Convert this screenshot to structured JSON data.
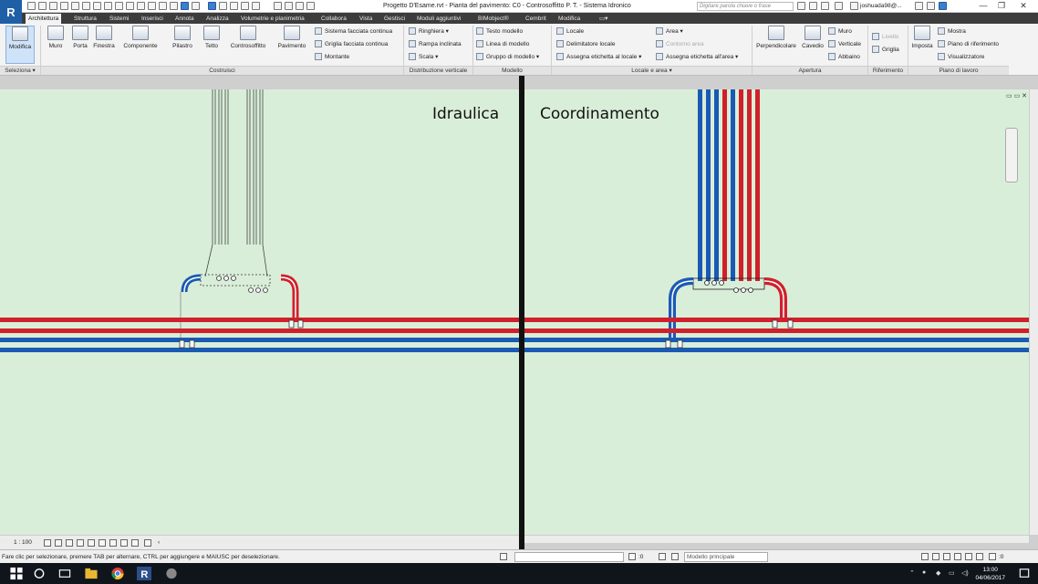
{
  "app": {
    "logo_letter": "R",
    "window_title": "Progetto D'Esame.rvt - Pianta del pavimento: C0 - Controsoffitto P. T. - Sistema Idronico",
    "search_placeholder": "Digitare parola chiave o frase",
    "username": "joshuada98@...",
    "window_controls": [
      "—",
      "❐",
      "✕"
    ]
  },
  "ribbon": {
    "tabs": [
      "Architettura",
      "Struttura",
      "Sistemi",
      "Inserisci",
      "Annota",
      "Analizza",
      "Volumetrie e planimetria",
      "Collabora",
      "Vista",
      "Gestisci",
      "Moduli aggiuntivi",
      "BIMobject®",
      "Cembrit",
      "Modifica",
      "▭▾"
    ],
    "active_tab": "Architettura",
    "seleziona": {
      "button": "Modifica",
      "panel": "Seleziona ▾"
    },
    "costruisci": {
      "panel": "Costruisci",
      "big_buttons": [
        "Muro",
        "Porta",
        "Finestra",
        "Componente",
        "Pilastro",
        "Tetto",
        "Controsoffitto",
        "Pavimento"
      ],
      "small_buttons": [
        "Sistema facciata continua",
        "Griglia facciata continua",
        "Montante"
      ]
    },
    "distribuzione": {
      "panel": "Distribuzione verticale",
      "items": [
        "Ringhiera ▾",
        "Rampa inclinata",
        "Scala ▾"
      ]
    },
    "modello": {
      "panel": "Modello",
      "items": [
        "Testo modello",
        "Linea di modello",
        "Gruppo di modello ▾"
      ]
    },
    "locale_area": {
      "panel": "Locale e area ▾",
      "items": [
        "Locale",
        "Delimitatore locale",
        "Assegna etichetta al locale ▾"
      ],
      "items2": [
        "Area ▾",
        "Contorno area",
        "Assegna etichetta all'area ▾"
      ]
    },
    "apertura": {
      "panel": "Apertura",
      "big_buttons": [
        "Perpendicolare",
        "Cavedio"
      ],
      "small_buttons": [
        "Muro",
        "Verticale",
        "Abbaino"
      ]
    },
    "riferimento": {
      "panel": "Riferimento",
      "items": [
        "Livello",
        "Griglia"
      ]
    },
    "piano_lavoro": {
      "panel": "Piano di lavoro",
      "big_button": "Imposta",
      "items": [
        "Mostra",
        "Piano di riferimento",
        "Visualizzatore"
      ]
    }
  },
  "views": {
    "left": {
      "title": "Idraulica",
      "scale": "1 : 100"
    },
    "right": {
      "title": "Coordinamento"
    }
  },
  "colors": {
    "supply": "#d0202c",
    "return": "#1a5ab4",
    "background": "#d9eed9"
  },
  "status": {
    "message": "Fare clic per selezionare, premere TAB per alternare, CTRL per aggiungere e MAIUSC per deselezionare.",
    "filter_count": ":0",
    "model_dropdown": "Modello principale",
    "right_count": ":0"
  },
  "taskbar": {
    "time": "13:00",
    "date": "04/06/2017"
  }
}
